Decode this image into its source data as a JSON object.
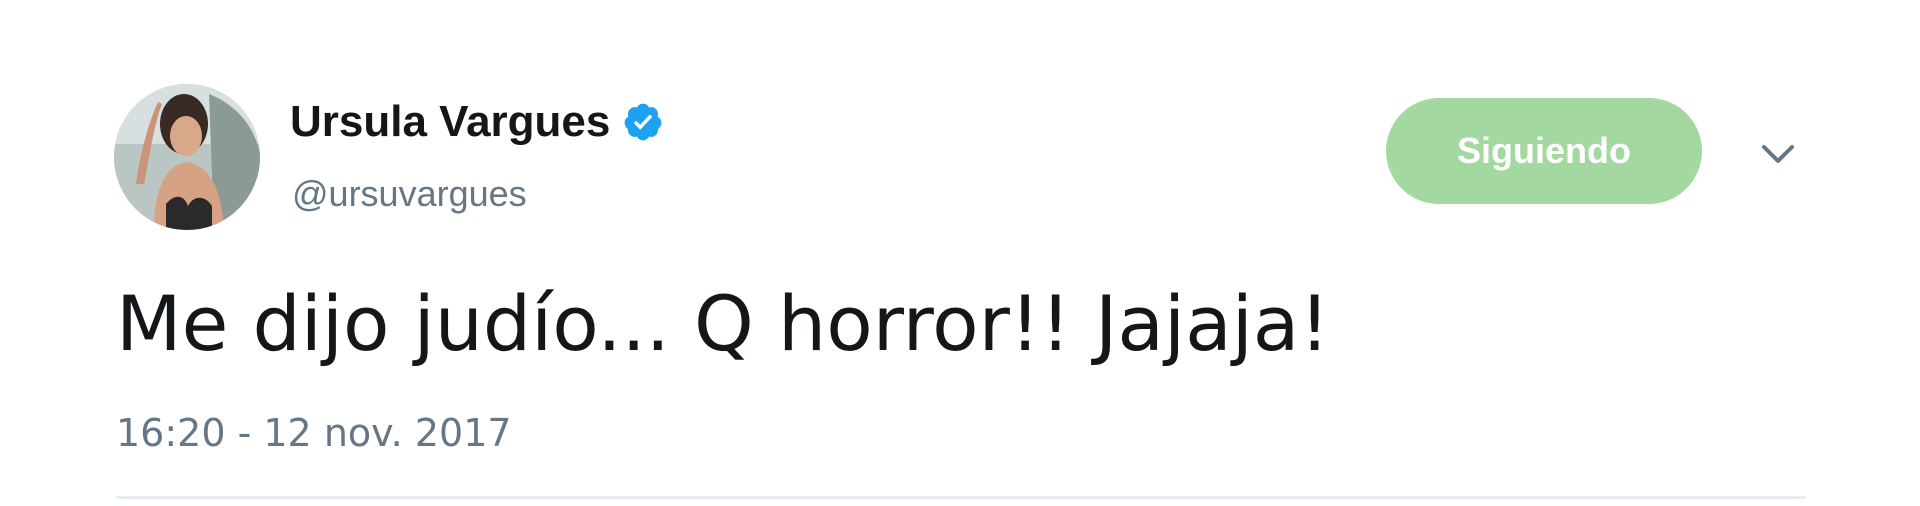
{
  "tweet": {
    "author": {
      "display_name": "Ursula Vargues",
      "handle": "@ursuvargues",
      "verified": true,
      "avatar": "profile-photo"
    },
    "follow_button": {
      "label": "Siguiendo",
      "color": "#a3d9a0"
    },
    "menu_icon": "chevron-down-icon",
    "text": "Me dijo judío... Q horror!! Jajaja!",
    "timestamp": "16:20 - 12 nov. 2017"
  },
  "colors": {
    "verified_badge": "#1da1f2",
    "primary_text": "#14171a",
    "secondary_text": "#657786"
  }
}
